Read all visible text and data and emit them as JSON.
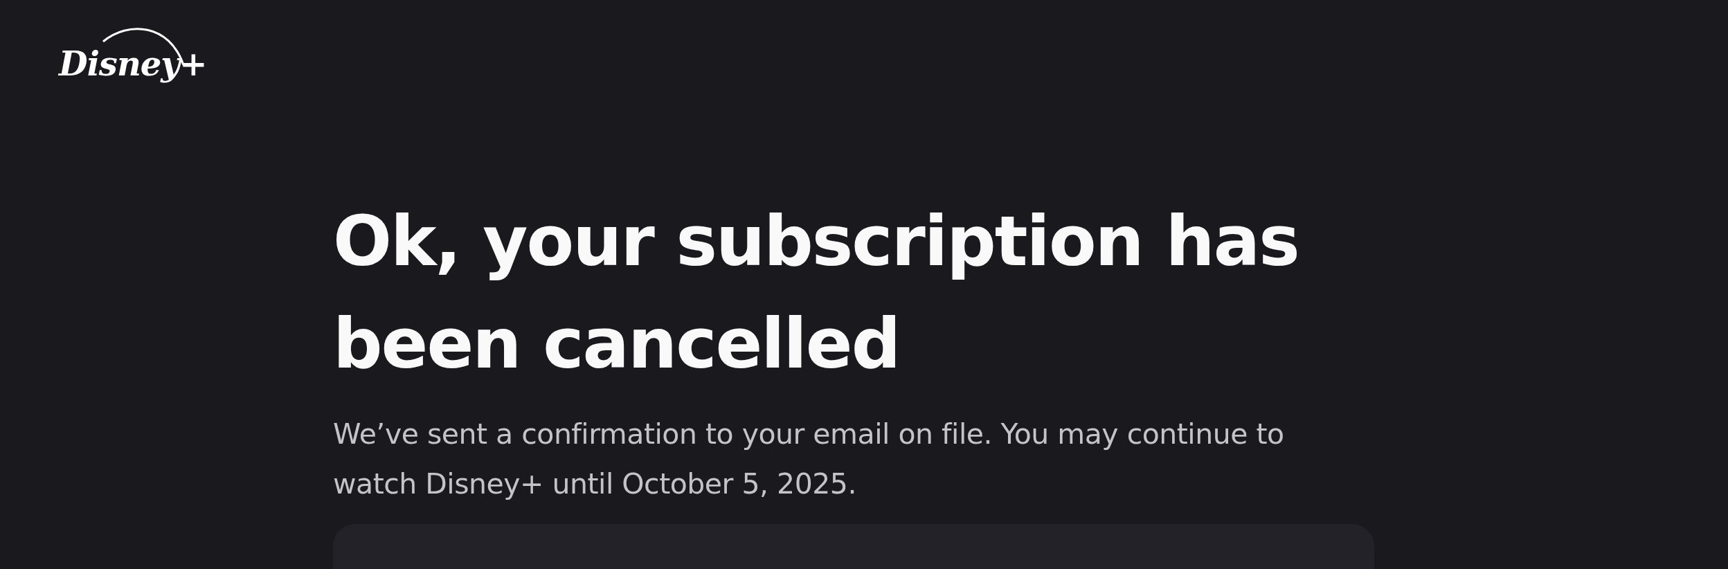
{
  "logo": {
    "text": "Disney+"
  },
  "heading": "Ok, your subscription has been cancelled",
  "message": "We’ve sent a confirmation to your email on file. You may continue to watch Disney+ until October 5, 2025."
}
